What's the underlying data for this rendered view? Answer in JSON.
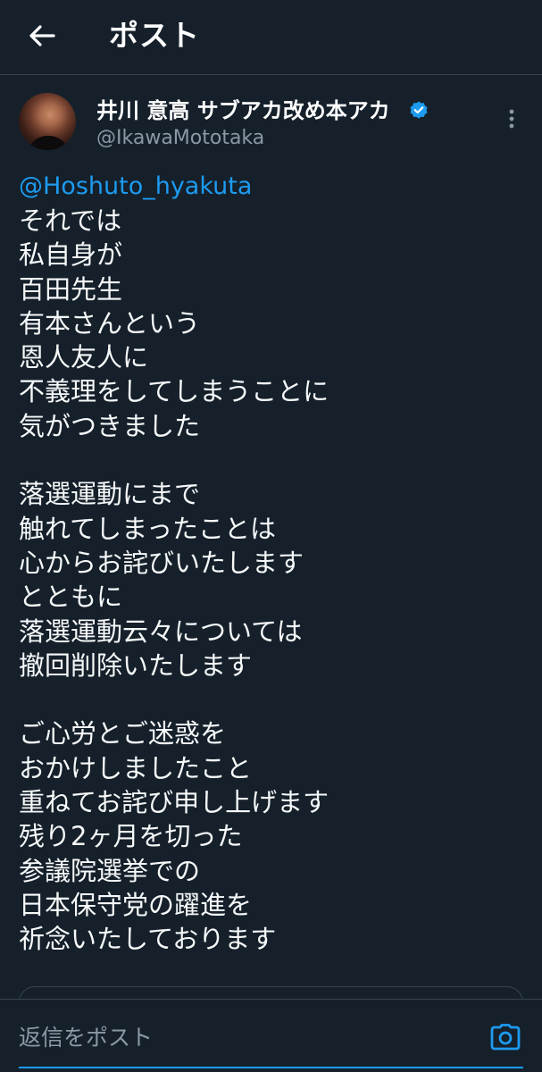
{
  "header": {
    "title": "ポスト",
    "back_icon": "arrow-left-icon"
  },
  "post": {
    "author": {
      "display_name": "井川 意高 サブアカ改め本アカ",
      "handle": "@IkawaMototaka",
      "verified": true,
      "verified_color": "#1d9bf0"
    },
    "mention": "@Hoshuto_hyakuta",
    "body": "それでは\n私自身が\n百田先生\n有本さんという\n恩人友人に\n不義理をしてしまうことに\n気がつきました\n\n落選運動にまで\n触れてしまったことは\n心からお詫びいたします\nとともに\n落選運動云々については\n撤回削除いたします\n\nご心労とご迷惑を\nおかけしましたこと\n重ねてお詫び申し上げます\n残り2ヶ月を切った\n参議院選挙での\n日本保守党の躍進を\n祈念いたしております"
  },
  "reply": {
    "placeholder": "返信をポスト",
    "camera_icon": "camera-icon"
  },
  "colors": {
    "background": "#15202b",
    "accent": "#1d9bf0",
    "secondary_text": "#8b98a5",
    "divider": "#38444d"
  }
}
